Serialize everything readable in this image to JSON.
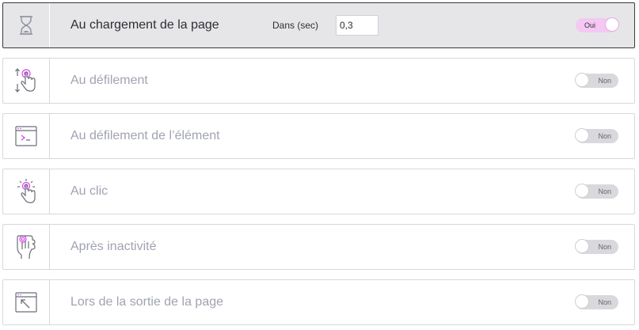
{
  "triggers": [
    {
      "label": "Au chargement de la page",
      "icon": "hourglass-icon",
      "enabled": true,
      "toggle_text": "Oui",
      "delay": {
        "label": "Dans (sec)",
        "value": "0,3"
      }
    },
    {
      "label": "Au défilement",
      "icon": "scroll-hand-icon",
      "enabled": false,
      "toggle_text": "Non"
    },
    {
      "label": "Au défilement de l’élément",
      "icon": "terminal-window-icon",
      "enabled": false,
      "toggle_text": "Non"
    },
    {
      "label": "Au clic",
      "icon": "click-hand-icon",
      "enabled": false,
      "toggle_text": "Non"
    },
    {
      "label": "Après inactivité",
      "icon": "inactivity-hand-icon",
      "enabled": false,
      "toggle_text": "Non"
    },
    {
      "label": "Lors de la sortie de la page",
      "icon": "exit-window-icon",
      "enabled": false,
      "toggle_text": "Non"
    }
  ],
  "colors": {
    "accent": "#d946ef",
    "toggle_on": "#f4c8f2",
    "toggle_off": "#d9d9dd",
    "active_row_bg": "#e6e6e9",
    "inactive_label": "#a0a3b1"
  }
}
